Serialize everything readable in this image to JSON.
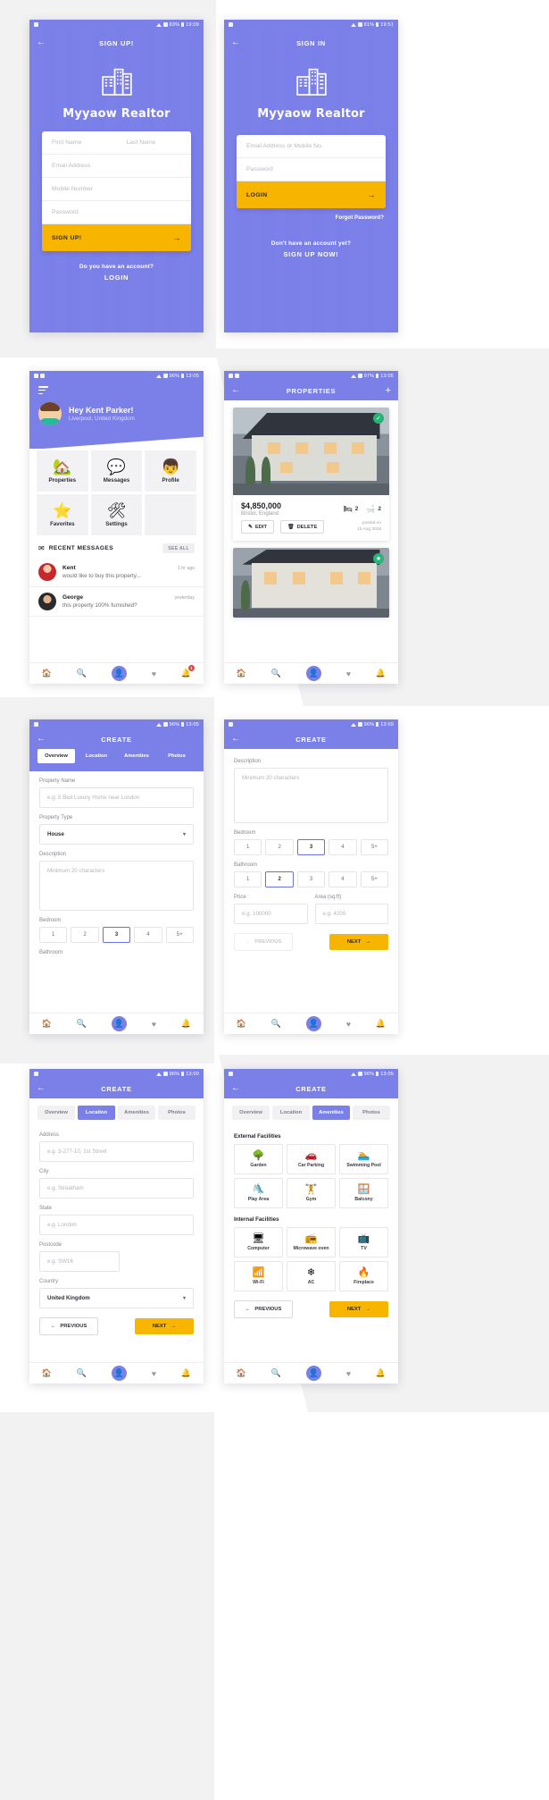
{
  "screens": {
    "signup": {
      "status": {
        "time": "19:09",
        "battery": "83%"
      },
      "title": "SIGN UP!",
      "back_icon": "back-arrow-icon",
      "brand": "Myyaow Realtor",
      "fields": {
        "first_name": "First Name",
        "last_name": "Last Name",
        "email": "Email Address",
        "mobile": "Mobile Number",
        "password": "Password"
      },
      "submit": "SIGN UP!",
      "footer_question": "Do you have an account?",
      "footer_action": "LOGIN"
    },
    "signin": {
      "status": {
        "time": "19:51",
        "battery": "81%"
      },
      "title": "SIGN IN",
      "brand": "Myyaow Realtor",
      "fields": {
        "email": "Email Address or Mobile No.",
        "password": "Password"
      },
      "submit": "LOGIN",
      "forgot": "Forgot Password?",
      "footer_question": "Don't have an account yet?",
      "footer_action": "SIGN UP NOW!"
    },
    "dashboard": {
      "status": {
        "time": "13:05",
        "battery": "96%"
      },
      "greeting": "Hey Kent Parker!",
      "location": "Liverpool, United Kingdom",
      "tiles": [
        {
          "label": "Properties",
          "icon": "house-icon"
        },
        {
          "label": "Messages",
          "icon": "chat-bubbles-icon"
        },
        {
          "label": "Profile",
          "icon": "person-icon"
        },
        {
          "label": "Favorites",
          "icon": "star-icon"
        },
        {
          "label": "Settings",
          "icon": "tools-icon"
        }
      ],
      "recent_title": "RECENT MESSAGES",
      "see_all": "SEE ALL",
      "messages": [
        {
          "name": "Kent",
          "preview": "would like to buy this property...",
          "time": "1 hr ago"
        },
        {
          "name": "George",
          "preview": "this property 100% furnished?",
          "time": "yesterday"
        }
      ],
      "nav_badge": "1"
    },
    "properties": {
      "status": {
        "time": "13:05",
        "battery": "97%"
      },
      "title": "PROPERTIES",
      "add_icon": "plus-icon",
      "items": [
        {
          "price": "$4,850,000",
          "city": "Bristol, England",
          "beds": "2",
          "baths": "2",
          "edit": "EDIT",
          "delete": "DELETE",
          "posted_label": "posted on",
          "posted_date": "15 Aug 2018",
          "badge": "check-icon"
        },
        {
          "badge": "star-icon"
        }
      ]
    },
    "create_overview": {
      "status": {
        "time": "13:05",
        "battery": "96%"
      },
      "title": "CREATE",
      "tabs": [
        "Overview",
        "Location",
        "Amenities",
        "Photos"
      ],
      "active_tab": "Overview",
      "property_name_label": "Property Name",
      "property_name_placeholder": "e.g. 5 Bed Luxury Home near London",
      "property_type_label": "Property Type",
      "property_type_value": "House",
      "description_label": "Description",
      "description_placeholder": "Minimum 20 characters",
      "bedroom_label": "Bedroom",
      "bedroom_options": [
        "1",
        "2",
        "3",
        "4",
        "5+"
      ],
      "bedroom_selected": "3",
      "bathroom_label": "Bathroom"
    },
    "create_overview2": {
      "status": {
        "time": "13:09",
        "battery": "96%"
      },
      "title": "CREATE",
      "description_label": "Description",
      "description_placeholder": "Minimum 20 characters",
      "bedroom_label": "Bedroom",
      "bedroom_options": [
        "1",
        "2",
        "3",
        "4",
        "5+"
      ],
      "bedroom_selected": "3",
      "bathroom_label": "Bathroom",
      "bathroom_options": [
        "1",
        "2",
        "3",
        "4",
        "5+"
      ],
      "bathroom_selected": "2",
      "price_label": "Price",
      "price_placeholder": "e.g. 100000",
      "area_label": "Area (sq.ft)",
      "area_placeholder": "e.g. 4200",
      "previous": "PREVIOUS",
      "next": "NEXT"
    },
    "create_location": {
      "status": {
        "time": "13:09",
        "battery": "96%"
      },
      "title": "CREATE",
      "tabs": [
        "Overview",
        "Location",
        "Amenities",
        "Photos"
      ],
      "active_tab": "Location",
      "address_label": "Address",
      "address_placeholder": "e.g. 3-277-10, 1st Street",
      "city_label": "City",
      "city_placeholder": "e.g. Streatham",
      "state_label": "State",
      "state_placeholder": "e.g. London",
      "postcode_label": "Postcode",
      "postcode_placeholder": "e.g. SW16",
      "country_label": "Country",
      "country_value": "United Kingdom",
      "previous": "PREVIOUS",
      "next": "NEXT"
    },
    "create_amenities": {
      "status": {
        "time": "13:05",
        "battery": "96%"
      },
      "title": "CREATE",
      "tabs": [
        "Overview",
        "Location",
        "Amenities",
        "Photos"
      ],
      "active_tab": "Amenities",
      "external_title": "External Facilities",
      "external": [
        {
          "label": "Garden",
          "icon": "garden-icon"
        },
        {
          "label": "Car Parking",
          "icon": "car-icon"
        },
        {
          "label": "Swimming Pool",
          "icon": "swimmer-icon"
        },
        {
          "label": "Play Area",
          "icon": "playground-icon"
        },
        {
          "label": "Gym",
          "icon": "dumbbell-icon"
        },
        {
          "label": "Balcony",
          "icon": "balcony-icon"
        }
      ],
      "internal_title": "Internal Facilities",
      "internal": [
        {
          "label": "Computer",
          "icon": "computer-icon"
        },
        {
          "label": "Microwave oven",
          "icon": "microwave-icon"
        },
        {
          "label": "TV",
          "icon": "tv-icon"
        },
        {
          "label": "Wi-Fi",
          "icon": "wifi-icon"
        },
        {
          "label": "AC",
          "icon": "air-conditioner-icon"
        },
        {
          "label": "Fireplace",
          "icon": "fireplace-icon"
        }
      ],
      "previous": "PREVIOUS",
      "next": "NEXT"
    }
  },
  "bottom_nav": {
    "items": [
      "home-icon",
      "search-icon",
      "profile-icon",
      "heart-icon",
      "notification-icon"
    ]
  },
  "colors": {
    "primary": "#7b7fe8",
    "accent": "#f7b500",
    "background": "#f2f2f3",
    "success": "#22b573",
    "danger": "#e8453c"
  }
}
